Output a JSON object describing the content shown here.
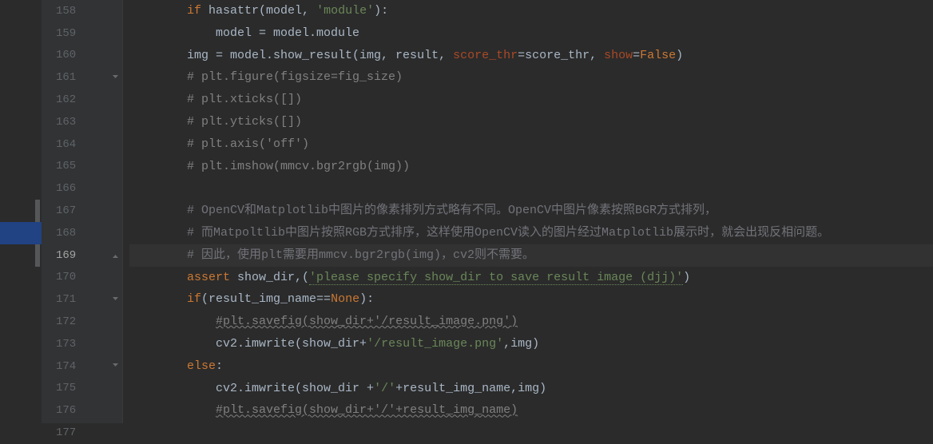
{
  "lines": [
    {
      "num": "158",
      "segments": [
        {
          "indent": 2,
          "tokens": [
            {
              "t": "if ",
              "c": "kw"
            },
            {
              "t": "hasattr(model, "
            },
            {
              "t": "'module'",
              "c": "str"
            },
            {
              "t": "):"
            }
          ]
        }
      ]
    },
    {
      "num": "159",
      "segments": [
        {
          "indent": 3,
          "tokens": [
            {
              "t": "model = model.module"
            }
          ]
        }
      ]
    },
    {
      "num": "160",
      "segments": [
        {
          "indent": 2,
          "tokens": [
            {
              "t": "img = model.show_result(img, result, "
            },
            {
              "t": "score_thr",
              "c": "param"
            },
            {
              "t": "=score_thr, "
            },
            {
              "t": "show",
              "c": "param"
            },
            {
              "t": "="
            },
            {
              "t": "False",
              "c": "const"
            },
            {
              "t": ")"
            }
          ]
        }
      ]
    },
    {
      "num": "161",
      "fold": "open",
      "segments": [
        {
          "indent": 2,
          "tokens": [
            {
              "t": "# plt.figure(figsize=fig_size)",
              "c": "com"
            }
          ]
        }
      ]
    },
    {
      "num": "162",
      "segments": [
        {
          "indent": 2,
          "tokens": [
            {
              "t": "# plt.xticks([])",
              "c": "com"
            }
          ]
        }
      ]
    },
    {
      "num": "163",
      "segments": [
        {
          "indent": 2,
          "tokens": [
            {
              "t": "# plt.yticks([])",
              "c": "com"
            }
          ]
        }
      ]
    },
    {
      "num": "164",
      "segments": [
        {
          "indent": 2,
          "tokens": [
            {
              "t": "# plt.axis('off')",
              "c": "com"
            }
          ]
        }
      ]
    },
    {
      "num": "165",
      "segments": [
        {
          "indent": 2,
          "tokens": [
            {
              "t": "# plt.imshow(mmcv.bgr2rgb(img))",
              "c": "com"
            }
          ]
        }
      ]
    },
    {
      "num": "166",
      "segments": [
        {
          "indent": 0,
          "tokens": [
            {
              "t": ""
            }
          ]
        }
      ]
    },
    {
      "num": "167",
      "segments": [
        {
          "indent": 2,
          "tokens": [
            {
              "t": "# OpenCV和Matplotlib中图片的像素排列方式略有不同。OpenCV中图片像素按照BGR方式排列，",
              "c": "com-cn"
            }
          ]
        }
      ]
    },
    {
      "num": "168",
      "segments": [
        {
          "indent": 2,
          "tokens": [
            {
              "t": "# 而Matpoltlib中图片按照RGB方式排序，这样使用OpenCV读入的图片经过Matplotlib展示时，就会出现反相问题。",
              "c": "com-cn"
            }
          ]
        }
      ]
    },
    {
      "num": "169",
      "current": true,
      "fold": "close",
      "segments": [
        {
          "indent": 2,
          "tokens": [
            {
              "t": "# 因此，使用plt需要用mmcv.bgr2rgb(img)，cv2则不需要。",
              "c": "com-cn"
            }
          ]
        }
      ]
    },
    {
      "num": "170",
      "segments": [
        {
          "indent": 2,
          "tokens": [
            {
              "t": "assert ",
              "c": "kw"
            },
            {
              "t": "show_dir,("
            },
            {
              "t": "'please specify show_dir to save result image (djj)'",
              "c": "str green-underline"
            },
            {
              "t": ")"
            }
          ]
        }
      ]
    },
    {
      "num": "171",
      "fold": "open",
      "segments": [
        {
          "indent": 2,
          "tokens": [
            {
              "t": "if",
              "c": "kw"
            },
            {
              "t": "(result_img_name=="
            },
            {
              "t": "None",
              "c": "const"
            },
            {
              "t": "):"
            }
          ]
        }
      ]
    },
    {
      "num": "172",
      "segments": [
        {
          "indent": 3,
          "tokens": [
            {
              "t": "#plt.savefig(show_dir+'/result_image.png')",
              "c": "com wavy"
            }
          ]
        }
      ]
    },
    {
      "num": "173",
      "segments": [
        {
          "indent": 3,
          "tokens": [
            {
              "t": "cv2.imwrite(show_dir+"
            },
            {
              "t": "'/result_image.png'",
              "c": "str"
            },
            {
              "t": ",img)"
            }
          ]
        }
      ]
    },
    {
      "num": "174",
      "fold": "open",
      "segments": [
        {
          "indent": 2,
          "tokens": [
            {
              "t": "else",
              "c": "kw"
            },
            {
              "t": ":"
            }
          ]
        }
      ]
    },
    {
      "num": "175",
      "segments": [
        {
          "indent": 3,
          "tokens": [
            {
              "t": "cv2.imwrite(show_dir +"
            },
            {
              "t": "'/'",
              "c": "str"
            },
            {
              "t": "+result_img_name,img)"
            }
          ]
        }
      ]
    },
    {
      "num": "176",
      "segments": [
        {
          "indent": 3,
          "tokens": [
            {
              "t": "#plt.savefig(show_dir+'/'+result_img_name)",
              "c": "com wavy"
            }
          ]
        }
      ]
    },
    {
      "num": "177",
      "segments": [
        {
          "indent": 0,
          "tokens": [
            {
              "t": ""
            }
          ]
        }
      ]
    }
  ],
  "indent_unit": "    ",
  "bookmark": {
    "start_idx": 9,
    "rows": 3
  },
  "highlight_row_idx": 10
}
